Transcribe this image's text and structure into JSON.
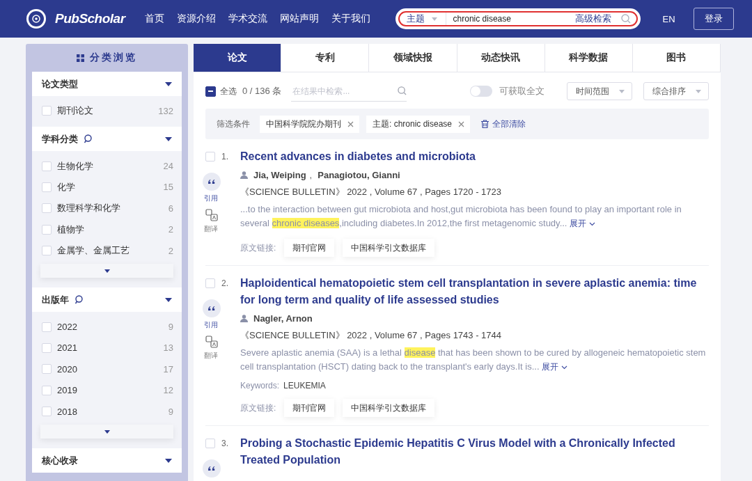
{
  "header": {
    "logo_text": "PubScholar",
    "nav": [
      "首页",
      "资源介绍",
      "学术交流",
      "网站声明",
      "关于我们"
    ],
    "search": {
      "field": "主题",
      "value": "chronic disease",
      "advanced": "高级检索"
    },
    "language": "EN",
    "login": "登录"
  },
  "sidebar": {
    "title": "分类浏览",
    "groups": [
      {
        "title": "论文类型",
        "searchable": false,
        "has_more": false,
        "items": [
          {
            "label": "期刊论文",
            "count": "132",
            "checked": false
          }
        ]
      },
      {
        "title": "学科分类",
        "searchable": true,
        "has_more": true,
        "items": [
          {
            "label": "生物化学",
            "count": "24",
            "checked": false
          },
          {
            "label": "化学",
            "count": "15",
            "checked": false
          },
          {
            "label": "数理科学和化学",
            "count": "6",
            "checked": false
          },
          {
            "label": "植物学",
            "count": "2",
            "checked": false
          },
          {
            "label": "金属学、金属工艺",
            "count": "2",
            "checked": false
          }
        ]
      },
      {
        "title": "出版年",
        "searchable": true,
        "has_more": true,
        "items": [
          {
            "label": "2022",
            "count": "9",
            "checked": false
          },
          {
            "label": "2021",
            "count": "13",
            "checked": false
          },
          {
            "label": "2020",
            "count": "17",
            "checked": false
          },
          {
            "label": "2019",
            "count": "12",
            "checked": false
          },
          {
            "label": "2018",
            "count": "9",
            "checked": false
          }
        ]
      },
      {
        "title": "核心收录",
        "searchable": false,
        "has_more": false
      }
    ]
  },
  "tabs": [
    {
      "label": "论文",
      "selected": true
    },
    {
      "label": "专利",
      "selected": false
    },
    {
      "label": "领域快报",
      "selected": false
    },
    {
      "label": "动态快讯",
      "selected": false
    },
    {
      "label": "科学数据",
      "selected": false
    },
    {
      "label": "图书",
      "selected": false
    }
  ],
  "toolbar": {
    "select_all": {
      "label": "全选",
      "indeterminate": true
    },
    "count": "0 / 136 条",
    "search_placeholder": "在结果中检索...",
    "fulltext": {
      "label": "可获取全文",
      "on": false
    },
    "time_range": "时间范围",
    "sort": "综合排序"
  },
  "filters": {
    "label": "筛选条件",
    "chips": [
      "中国科学院院办期刊",
      "主题: chronic disease"
    ],
    "clear": "全部清除"
  },
  "results": [
    {
      "number": "1.",
      "checked": false,
      "title": "Recent advances in diabetes and microbiota",
      "authors": [
        "Jia, Weiping",
        "Panagiotou, Gianni"
      ],
      "author_separator": ",",
      "source": "《SCIENCE BULLETIN》 2022 , Volume 67 , Pages 1720 - 1723",
      "abstract": [
        {
          "text": "...to the interaction between gut microbiota and host,gut microbiota has been found to play an important role in several ",
          "highlight": false
        },
        {
          "text": "chronic diseases",
          "highlight": true
        },
        {
          "text": ",including diabetes.In 2012,the first metagenomic study...",
          "highlight": false
        }
      ],
      "expand": "展开",
      "links_label": "原文链接:",
      "links": [
        "期刊官网",
        "中国科学引文数据库"
      ],
      "cite": "引用",
      "translate": "翻译"
    },
    {
      "number": "2.",
      "checked": false,
      "title": "Haploidentical hematopoietic stem cell transplantation in severe aplastic anemia: time for long term and quality of life assessed studies",
      "authors": [
        "Nagler, Arnon"
      ],
      "source": "《SCIENCE BULLETIN》 2022 , Volume 67 , Pages 1743 - 1744",
      "abstract": [
        {
          "text": "Severe aplastic anemia (SAA) is a lethal ",
          "highlight": false
        },
        {
          "text": "disease",
          "highlight": true
        },
        {
          "text": " that has been shown to be cured by allogeneic hematopoietic stem cell transplantation (HSCT) dating back to the transplant's early days.It is...",
          "highlight": false
        }
      ],
      "expand": "展开",
      "keywords_label": "Keywords:",
      "keywords": "LEUKEMIA",
      "links_label": "原文链接:",
      "links": [
        "期刊官网",
        "中国科学引文数据库"
      ],
      "cite": "引用",
      "translate": "翻译"
    },
    {
      "number": "3.",
      "checked": false,
      "title": "Probing a Stochastic Epidemic Hepatitis C Virus Model with a Chronically Infected Treated Population",
      "cite_icon": true
    }
  ]
}
